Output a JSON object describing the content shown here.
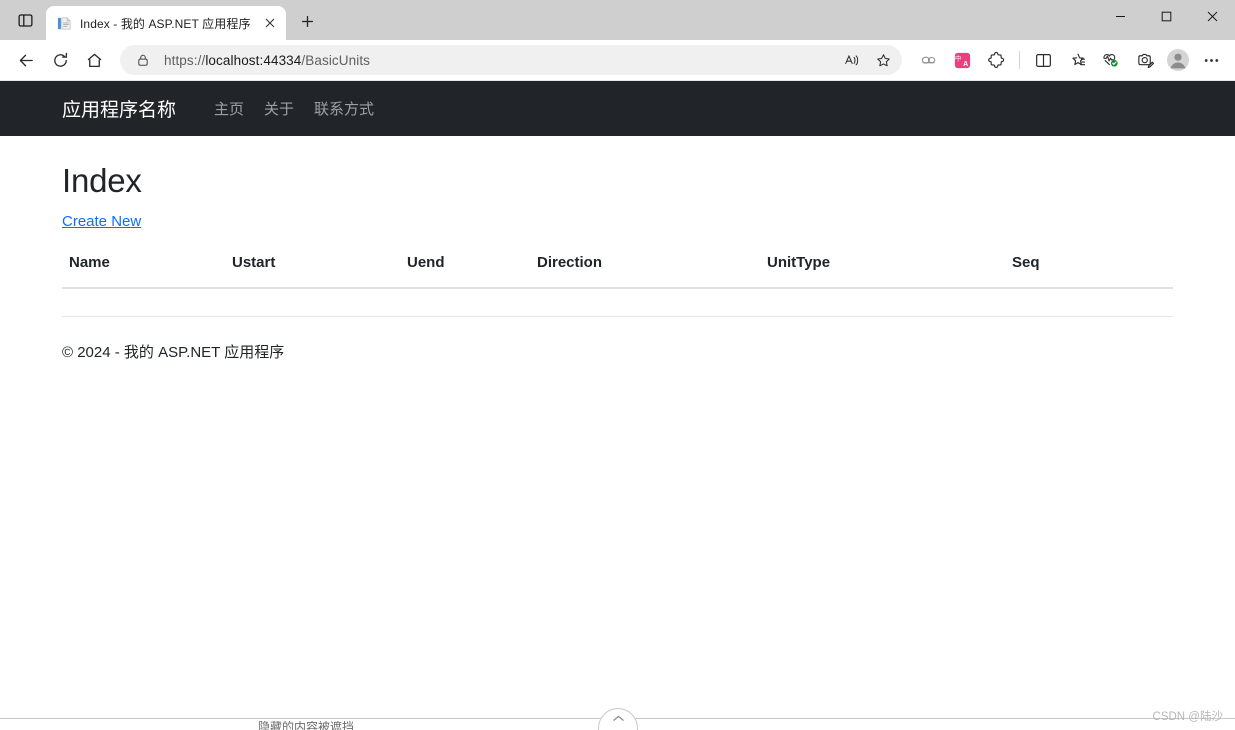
{
  "browser": {
    "tab_actions_icon": "tab-actions-icon",
    "tab": {
      "favicon": "document-favicon",
      "title": "Index - 我的 ASP.NET 应用程序",
      "close_icon": "close-icon"
    },
    "new_tab_icon": "plus-icon",
    "window_controls": {
      "minimize_icon": "minimize-icon",
      "maximize_icon": "maximize-icon",
      "close_icon": "close-icon"
    },
    "toolbar": {
      "back_icon": "back-arrow-icon",
      "refresh_icon": "refresh-icon",
      "home_icon": "home-icon",
      "lock_icon": "lock-icon",
      "url_full": "https://localhost:44334/BasicUnits",
      "url_scheme": "https://",
      "url_host": "localhost:44334",
      "url_path": "/BasicUnits",
      "read_aloud_icon": "read-aloud-icon",
      "favorite_icon": "star-outline-icon",
      "copilot_icon": "copilot-icon",
      "translate_icon": "translate-icon",
      "extensions_icon": "extensions-puzzle-icon",
      "split_screen_icon": "split-screen-icon",
      "favorites_icon": "favorites-star-list-icon",
      "browser_essentials_icon": "browser-essentials-icon",
      "collections_icon": "collections-icon",
      "profile_icon": "profile-avatar-icon",
      "settings_more_icon": "more-ellipsis-icon"
    },
    "colors": {
      "tabstrip_bg": "#cfcfcf",
      "toolbar_bg": "#ffffff",
      "omnibox_bg": "#f0f0f0",
      "translate_badge": "#e8417e",
      "essentials_badge": "#1a8c36"
    }
  },
  "page": {
    "navbar": {
      "brand": "应用程序名称",
      "links": [
        {
          "label": "主页",
          "name": "nav-link-home"
        },
        {
          "label": "关于",
          "name": "nav-link-about"
        },
        {
          "label": "联系方式",
          "name": "nav-link-contact"
        }
      ],
      "bg_color": "#212529"
    },
    "title": "Index",
    "create_link": "Create New",
    "table": {
      "columns": [
        "Name",
        "Ustart",
        "Uend",
        "Direction",
        "UnitType",
        "Seq"
      ],
      "rows": []
    },
    "footer": "© 2024 - 我的 ASP.NET 应用程序"
  },
  "overlay": {
    "watermark": "CSDN @陆沙",
    "collapse_icon": "chevron-up-icon",
    "ghost_text": "隐藏的内容被遮挡"
  }
}
